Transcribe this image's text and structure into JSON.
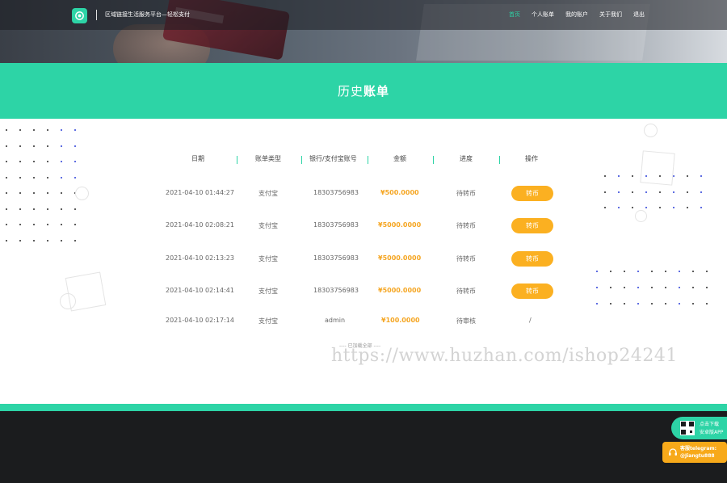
{
  "header": {
    "brand_name": "区域链接生活服务平台—轻松支付",
    "nav": [
      {
        "label": "首页",
        "active": true
      },
      {
        "label": "个人账单",
        "active": false
      },
      {
        "label": "我的账户",
        "active": false
      },
      {
        "label": "关于我们",
        "active": false
      },
      {
        "label": "退出",
        "active": false
      }
    ]
  },
  "title": {
    "part1": "历史",
    "part2": "账单"
  },
  "table": {
    "headers": [
      "日期",
      "账单类型",
      "银行/支付宝账号",
      "金额",
      "进度",
      "操作"
    ],
    "rows": [
      {
        "date": "2021-04-10 01:44:27",
        "type": "支付宝",
        "account": "18303756983",
        "amount": "¥500.0000",
        "status": "待转币",
        "action": "转币"
      },
      {
        "date": "2021-04-10 02:08:21",
        "type": "支付宝",
        "account": "18303756983",
        "amount": "¥5000.0000",
        "status": "待转币",
        "action": "转币"
      },
      {
        "date": "2021-04-10 02:13:23",
        "type": "支付宝",
        "account": "18303756983",
        "amount": "¥5000.0000",
        "status": "待转币",
        "action": "转币"
      },
      {
        "date": "2021-04-10 02:14:41",
        "type": "支付宝",
        "account": "18303756983",
        "amount": "¥5000.0000",
        "status": "待转币",
        "action": "转币"
      },
      {
        "date": "2021-04-10 02:17:14",
        "type": "支付宝",
        "account": "admin",
        "amount": "¥100.0000",
        "status": "待审核",
        "action": "/"
      }
    ]
  },
  "loaded_text": "---- 已加载全部 ----",
  "watermark": "https://www.huzhan.com/ishop24241",
  "floating": {
    "app_line1": "点击下载",
    "app_line2": "安卓版APP",
    "tg_line1": "客服telegram:",
    "tg_line2": "@Jiangtu888"
  },
  "colors": {
    "accent": "#2dd4a6",
    "button": "#fbb021",
    "amount": "#f5a623",
    "footer": "#1b1c1e"
  }
}
